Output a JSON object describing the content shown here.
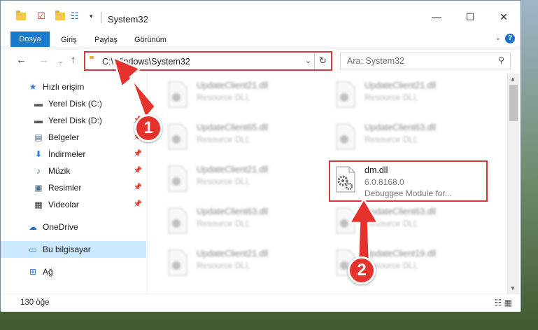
{
  "window": {
    "title": "System32",
    "controls": {
      "minimize": "—",
      "maximize": "☐",
      "close": "✕"
    }
  },
  "ribbon": {
    "tabs": [
      "Dosya",
      "Giriş",
      "Paylaş",
      "Görünüm"
    ],
    "help": "?"
  },
  "nav": {
    "address": "C:\\Windows\\System32",
    "search_placeholder": "Ara: System32"
  },
  "sidebar": {
    "items": [
      {
        "label": "Hızlı erişim",
        "icon": "star-icon"
      },
      {
        "label": "Yerel Disk (C:)",
        "icon": "drive-icon"
      },
      {
        "label": "Yerel Disk (D:)",
        "icon": "drive-icon"
      },
      {
        "label": "Belgeler",
        "icon": "document-icon"
      },
      {
        "label": "İndirmeler",
        "icon": "download-icon"
      },
      {
        "label": "Müzik",
        "icon": "music-icon"
      },
      {
        "label": "Resimler",
        "icon": "pictures-icon"
      },
      {
        "label": "Videolar",
        "icon": "video-icon"
      },
      {
        "label": "OneDrive",
        "icon": "cloud-icon"
      },
      {
        "label": "Bu bilgisayar",
        "icon": "computer-icon"
      },
      {
        "label": "Ağ",
        "icon": "network-icon"
      }
    ]
  },
  "files": [
    {
      "name": "UpdateClient21.dll",
      "type": "Resource DLL"
    },
    {
      "name": "UpdateClient21.dll",
      "type": "Resource DLL"
    },
    {
      "name": "UpdateClient65.dll",
      "type": "Resource DLL"
    },
    {
      "name": "UpdateClient63.dll",
      "type": "Resource DLL"
    },
    {
      "name": "UpdateClient21.dll",
      "type": "Resource DLL"
    },
    {
      "name": "dm.dll",
      "type": "6.0.8168.0",
      "more": "Debuggee Module for..."
    },
    {
      "name": "UpdateClient63.dll",
      "type": "Resource DLL"
    },
    {
      "name": "UpdateClient63.dll",
      "type": "Resource DLL"
    },
    {
      "name": "UpdateClient21.dll",
      "type": "Resource DLL"
    },
    {
      "name": "UpdateClient19.dll",
      "type": "Resource DLL"
    }
  ],
  "status": {
    "count": "130 öğe"
  },
  "annotations": {
    "marker1": "1",
    "marker2": "2"
  },
  "colors": {
    "accent": "#1979ca",
    "highlight": "#d63a3a",
    "marker": "#e5322d",
    "selected": "#cce8ff"
  }
}
